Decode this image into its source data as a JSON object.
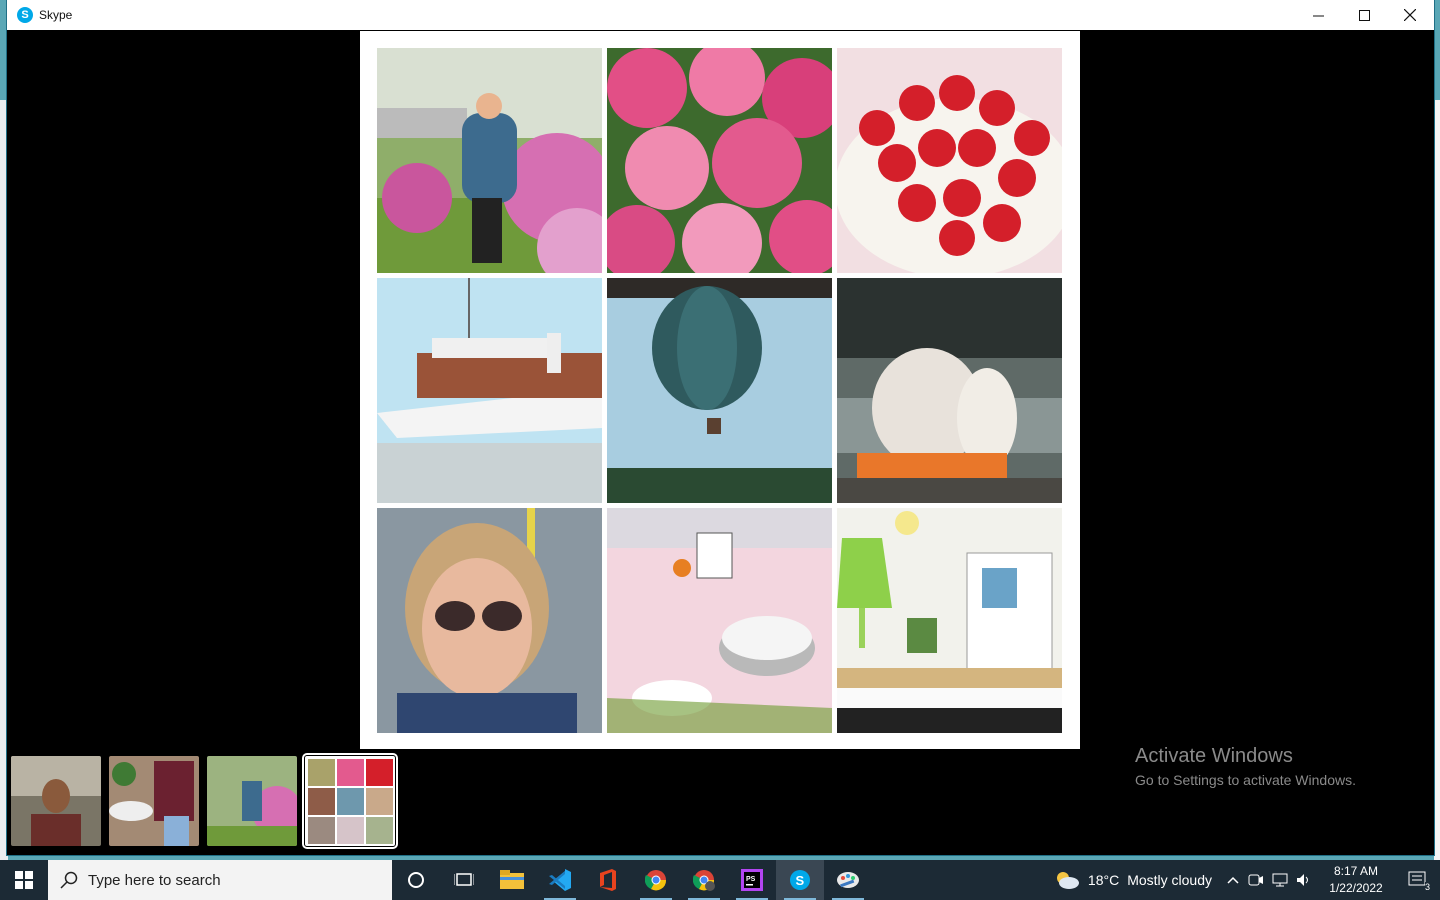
{
  "window": {
    "title": "Skype",
    "logo_letter": "S"
  },
  "viewer": {
    "collage_tiles": [
      "woman-in-rhododendron-garden",
      "pink-rhododendron-flowers",
      "strawberries-plate",
      "steamboat-at-pier",
      "hot-air-balloon",
      "bonfire-fireworks-lake",
      "woman-selfie-sunglasses",
      "table-with-cooking-pot",
      "orchid-lamp-piano-book"
    ],
    "thumbnails": [
      "man-portrait",
      "woman-seated-flowers",
      "woman-in-garden",
      "photo-collage"
    ],
    "active_thumbnail": 4
  },
  "watermark": {
    "title": "Activate Windows",
    "subtitle": "Go to Settings to activate Windows."
  },
  "taskbar": {
    "search_placeholder": "Type here to search",
    "apps": [
      "cortana",
      "task-view",
      "file-explorer",
      "vscode",
      "office",
      "chrome",
      "chrome-profile",
      "phpstorm",
      "skype",
      "paint"
    ],
    "weather": {
      "temp": "18°C",
      "condition": "Mostly cloudy"
    },
    "time": "8:17 AM",
    "date": "1/22/2022",
    "notifications": "3"
  }
}
